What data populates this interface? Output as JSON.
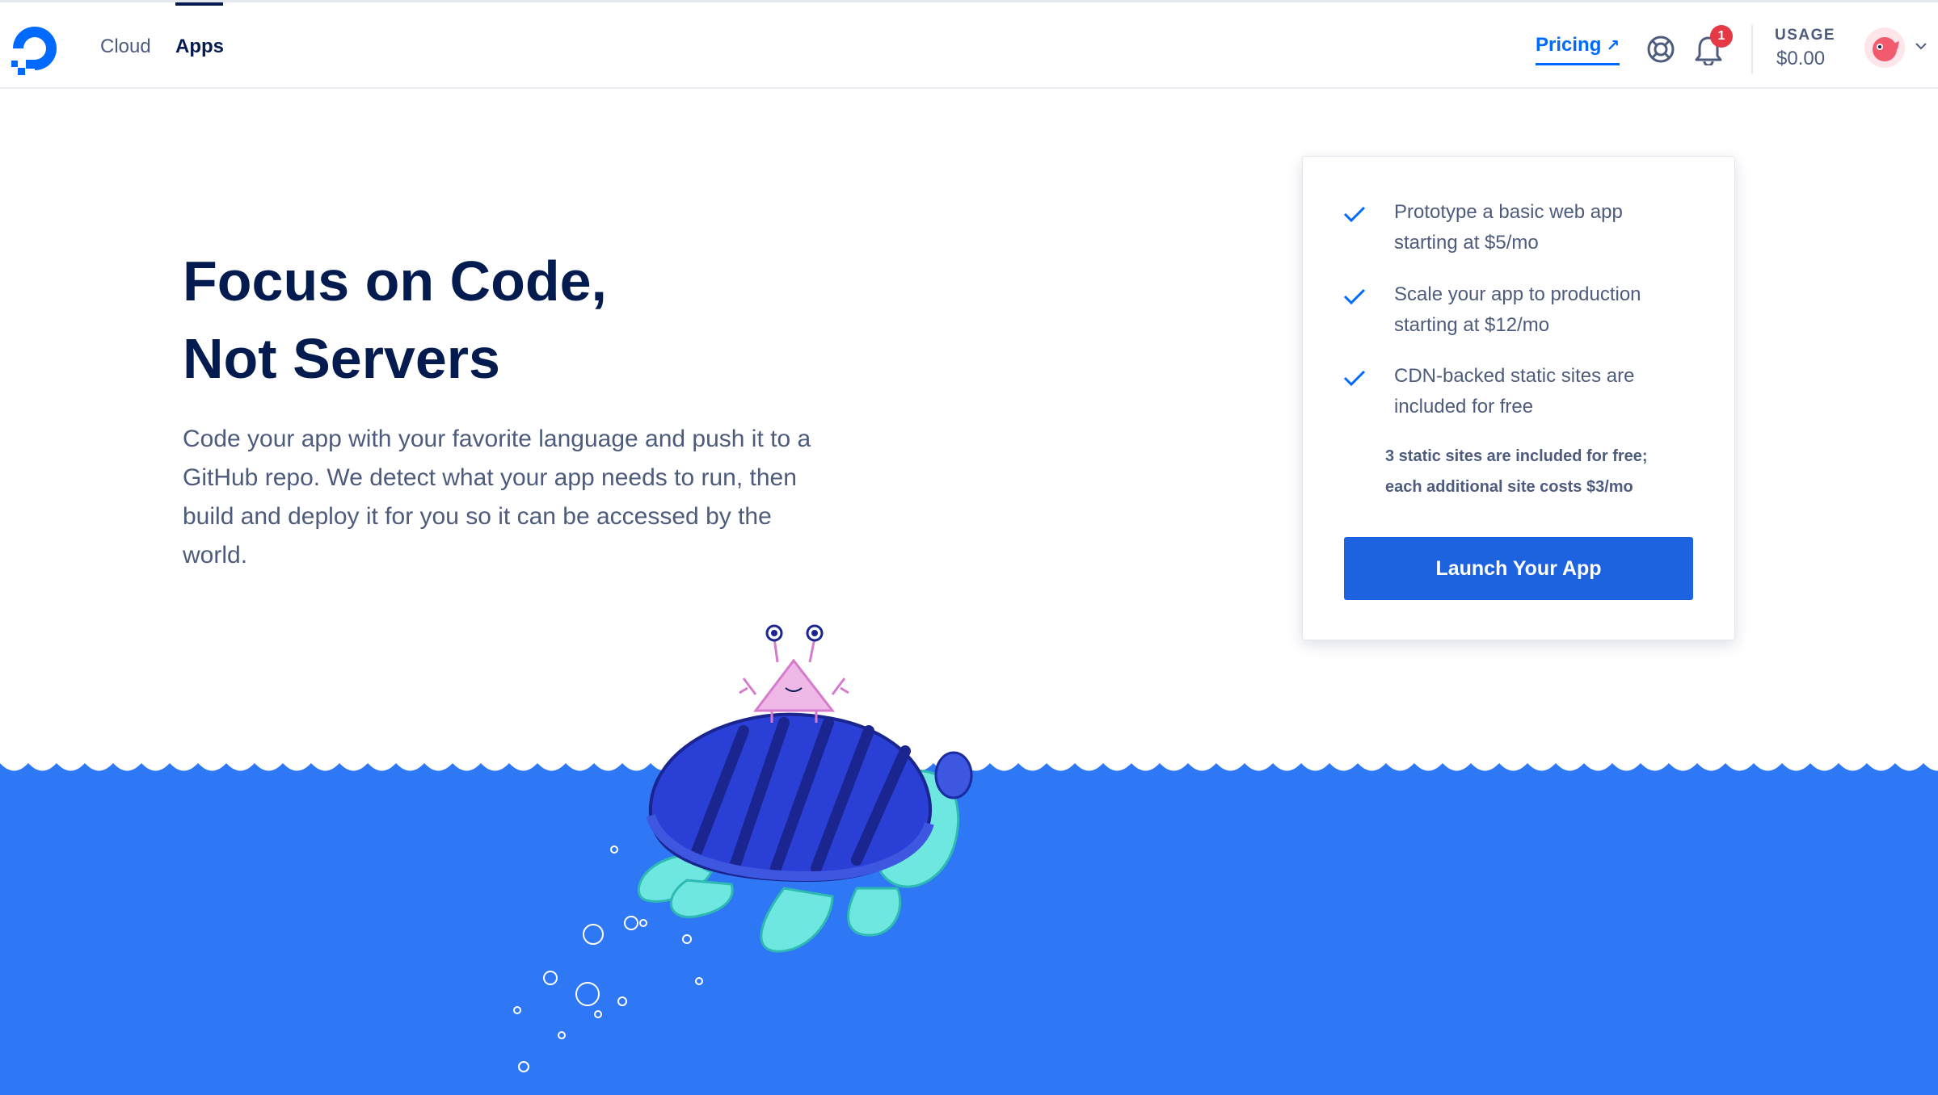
{
  "nav": {
    "tabs": [
      {
        "label": "Cloud"
      },
      {
        "label": "Apps"
      }
    ],
    "pricing_label": "Pricing",
    "pricing_arrow": "↗",
    "notification_count": "1",
    "usage_label": "USAGE",
    "usage_value": "$0.00"
  },
  "hero": {
    "title_line1": "Focus on Code,",
    "title_line2": "Not Servers",
    "description": "Code your app with your favorite language and push it to a GitHub repo. We detect what your app needs to run, then build and deploy it for you so it can be accessed by the world."
  },
  "card": {
    "features": [
      {
        "line1": "Prototype a basic web app",
        "line2": "starting at $5/mo"
      },
      {
        "line1": "Scale your app to production",
        "line2": "starting at $12/mo"
      },
      {
        "line1": "CDN-backed static sites are",
        "line2": "included for free"
      }
    ],
    "note_line1": "3 static sites are included for free;",
    "note_line2": "each additional site costs $3/mo",
    "button_label": "Launch Your App"
  },
  "icons": {
    "logo": "digitalocean-logo-icon",
    "help": "help-lifebuoy-icon",
    "bell": "bell-icon",
    "check": "check-icon",
    "chevron": "chevron-down-icon"
  },
  "colors": {
    "brand_blue": "#0069ff",
    "button_blue": "#1d63e0",
    "ocean_blue": "#2e77f5",
    "navy": "#031b4e",
    "body_text": "#4d5b7c",
    "badge_red": "#e63946"
  }
}
